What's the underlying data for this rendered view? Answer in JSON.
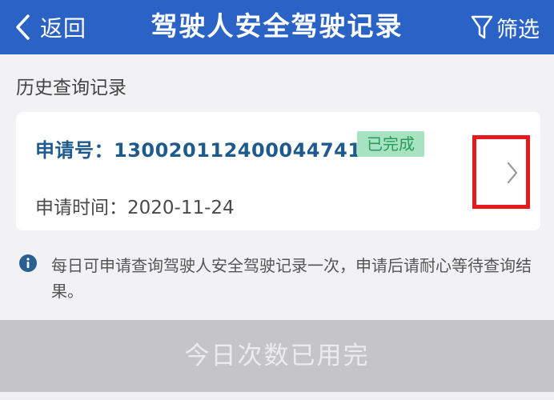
{
  "header": {
    "back_label": "返回",
    "title": "驾驶人安全驾驶记录",
    "filter_label": "筛选"
  },
  "section": {
    "title": "历史查询记录"
  },
  "record": {
    "application_no": "申请号：130020112400044741",
    "status": "已完成",
    "apply_time": "申请时间：2020-11-24"
  },
  "notice": {
    "text": "每日可申请查询驾驶人安全驾驶记录一次，申请后请耐心等待查询结果。"
  },
  "bottom_button": {
    "label": "今日次数已用完"
  },
  "colors": {
    "header_bg": "#2a63c5",
    "badge_bg": "#a7e3c1",
    "badge_text": "#2a9b59",
    "highlight": "#e6191c",
    "disabled_button": "#c5c5c7"
  },
  "icons": {
    "back": "chevron-left-icon",
    "filter": "funnel-icon",
    "detail": "chevron-right-icon",
    "info": "info-icon"
  }
}
